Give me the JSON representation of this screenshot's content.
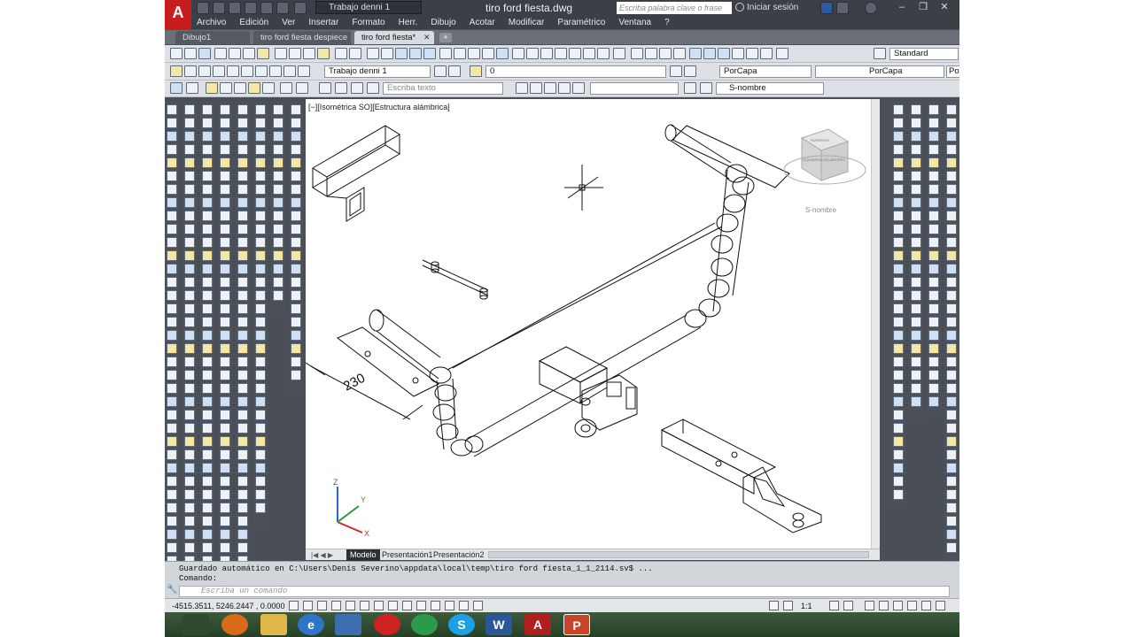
{
  "app": {
    "title": "tiro ford fiesta.dwg",
    "workspace": "Trabajo denni 1",
    "search_placeholder": "Escriba palabra clave o frase",
    "signin_label": "Iniciar sesión",
    "logo": "A",
    "window_controls": [
      "–",
      "❐",
      "✕"
    ]
  },
  "menus": [
    "Archivo",
    "Edición",
    "Ver",
    "Insertar",
    "Formato",
    "Herr.",
    "Dibujo",
    "Acotar",
    "Modificar",
    "Paramétrico",
    "Ventana",
    "?"
  ],
  "file_tabs": [
    {
      "label": "Dibujo1",
      "active": false
    },
    {
      "label": "tiro ford fiesta despiece",
      "active": false
    },
    {
      "label": "tiro ford fiesta*",
      "active": true
    }
  ],
  "toolbars": {
    "text_style": "Standard",
    "workspace_dropdown": "Trabajo denni 1",
    "layer_dropdown": "0",
    "color_dropdown": "PorCapa",
    "linetype_dropdown": "PorCapa",
    "lineweight_dropdown": "PorCa",
    "text_input_placeholder": "Escriba texto",
    "ucs_dropdown": "S-nombre"
  },
  "viewport": {
    "label": "[−][Isométrica SO][Estructura alámbrica]",
    "dimension_value": "230",
    "viewcube_ucs": "S-nombre",
    "viewcube_faces": [
      "SUPERIOR",
      "IZQUIERDO",
      "DELANTERO"
    ],
    "axis_labels": [
      "Z",
      "Y",
      "X"
    ]
  },
  "layout_tabs": [
    {
      "label": "Modelo",
      "active": true
    },
    {
      "label": "Presentación1",
      "active": false
    },
    {
      "label": "Presentación2",
      "active": false
    }
  ],
  "command_line": {
    "history_line1": "Guardado automático en C:\\Users\\Denis Severino\\appdata\\local\\temp\\tiro ford fiesta_1_1_2114.sv$ ...",
    "history_line2": "Comando:",
    "input_placeholder": "Escriba un comando"
  },
  "status": {
    "coordinates": "-4515.3511, 5246.2447 , 0.0000",
    "scale": "1:1"
  },
  "colors": {
    "accent_red": "#c81d1d",
    "app_dark": "#3b3f46",
    "drawing_background": "#ffffff"
  }
}
